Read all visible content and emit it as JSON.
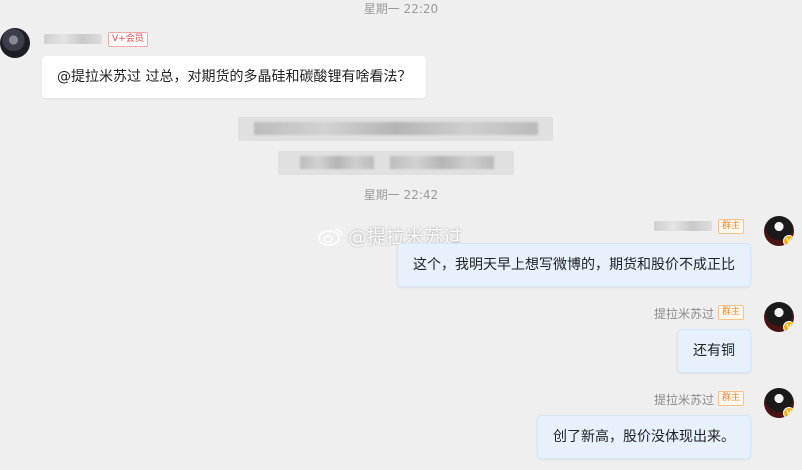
{
  "timestamps": [
    "星期一 22:20",
    "星期一 22:42"
  ],
  "badges": {
    "vip": "V+会员",
    "group_owner": "群主"
  },
  "messages": [
    {
      "side": "left",
      "sender": "",
      "text": "@提拉米苏过 过总，对期货的多晶硅和碳酸锂有啥看法？"
    },
    {
      "side": "right",
      "sender": "",
      "text": "这个，我明天早上想写微博的，期货和股价不成正比"
    },
    {
      "side": "right",
      "sender": "提拉米苏过",
      "text": "还有铜"
    },
    {
      "side": "right",
      "sender": "提拉米苏过",
      "text": "创了新高，股价没体现出来。"
    }
  ],
  "watermark": {
    "text": "@提拉米苏过",
    "icon": "weibo-logo-icon"
  },
  "avatar_badge": "V"
}
